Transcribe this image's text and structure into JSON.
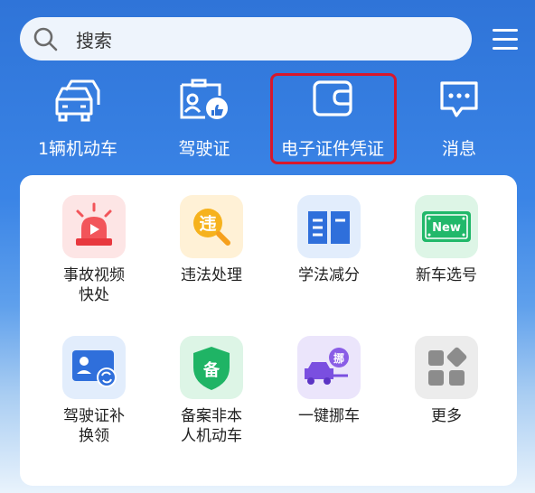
{
  "search": {
    "placeholder": "搜索"
  },
  "top_nav": {
    "vehicles": "1辆机动车",
    "license": "驾驶证",
    "e_license": "电子证件凭证",
    "messages": "消息"
  },
  "grid": {
    "accident": {
      "line1": "事故视频",
      "line2": "快处"
    },
    "violation": {
      "line1": "违法处理"
    },
    "study": {
      "line1": "学法减分"
    },
    "newcar": {
      "line1": "新车选号",
      "badge": "New"
    },
    "replace": {
      "line1": "驾驶证补",
      "line2": "换领"
    },
    "register": {
      "line1": "备案非本",
      "line2": "人机动车",
      "glyph": "备"
    },
    "move": {
      "line1": "一键挪车",
      "glyph": "挪"
    },
    "more": {
      "line1": "更多"
    }
  },
  "colors": {
    "highlight": "#d8172b",
    "accent_blue": "#2f74d8"
  }
}
